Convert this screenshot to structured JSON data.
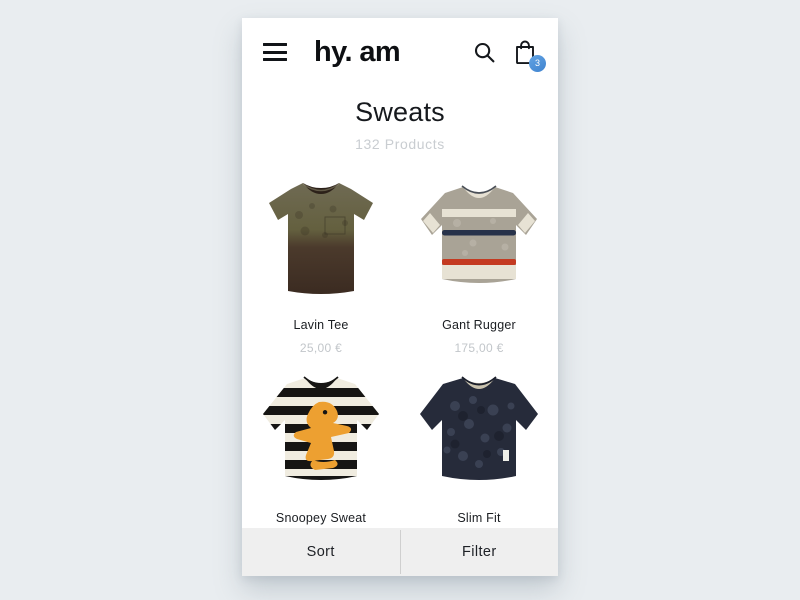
{
  "header": {
    "menu_icon": "hamburger-menu-icon",
    "logo": "hy. am",
    "search_icon": "search-icon",
    "bag_icon": "shopping-bag-icon",
    "bag_count": "3",
    "badge_color": "#4a90d9"
  },
  "page": {
    "title": "Sweats",
    "subtitle": "132 Products"
  },
  "products": [
    {
      "name": "Lavin Tee",
      "price": "25,00 €",
      "image": "olive-brown-gradient-tee"
    },
    {
      "name": "Gant Rugger",
      "price": "175,00 €",
      "image": "grey-striped-crewneck-sweater"
    },
    {
      "name": "Snoopey Sweat",
      "price": "",
      "image": "cream-black-striped-woodstock-sweater"
    },
    {
      "name": "Slim Fit",
      "price": "",
      "image": "navy-mottled-longsleeve-sweater"
    }
  ],
  "bottom_bar": {
    "sort_label": "Sort",
    "filter_label": "Filter"
  }
}
